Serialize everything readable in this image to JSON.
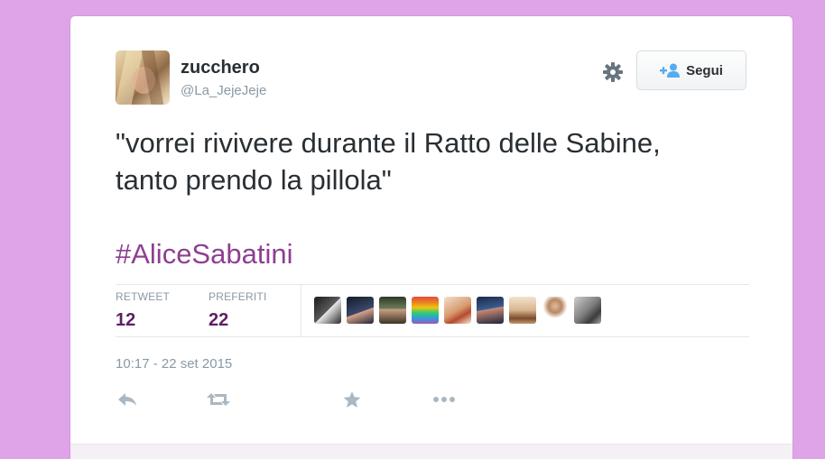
{
  "tweet": {
    "display_name": "zucchero",
    "handle": "@La_JejeJeje",
    "text_line1": "\"vorrei rivivere durante il Ratto delle Sabine,",
    "text_line2": "tanto prendo la pillola\"",
    "hashtag": "#AliceSabatini",
    "timestamp": "10:17 - 22 set 2015"
  },
  "follow": {
    "label": "Segui",
    "icon": "add-user-icon"
  },
  "settings": {
    "icon": "gear-icon"
  },
  "stats": {
    "retweet_label": "RETWEET",
    "retweet_count": "12",
    "favorites_label": "PREFERITI",
    "favorites_count": "22"
  },
  "favorited_by_count": 9,
  "actions": [
    "reply-icon",
    "retweet-icon",
    "favorite-icon",
    "more-icon"
  ],
  "colors": {
    "page_background": "#dfa4e8",
    "hashtag": "#8e3f91",
    "stat_value": "#5e2063",
    "muted_text": "#8899a6"
  }
}
